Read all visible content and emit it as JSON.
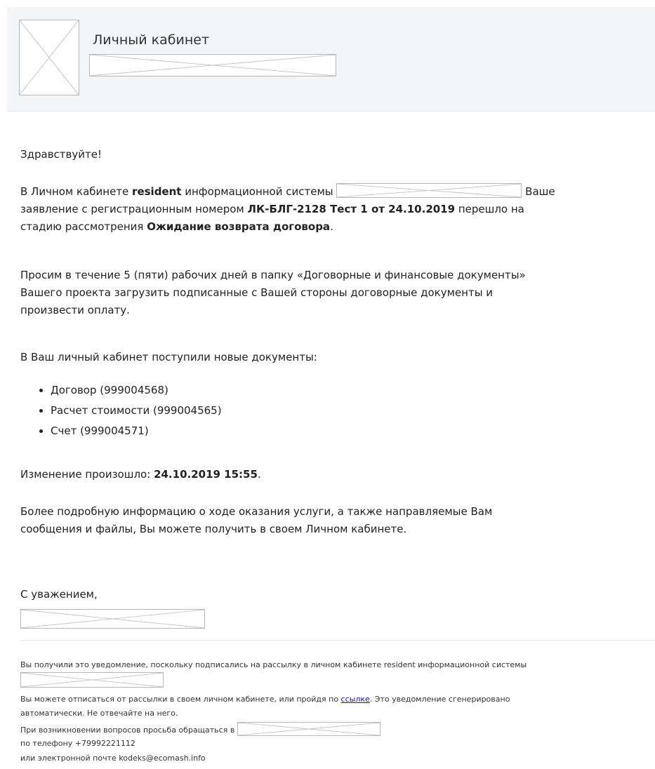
{
  "header": {
    "title": "Личный кабинет"
  },
  "greeting": "Здравствуйте!",
  "status_paragraph": {
    "part1": "В Личном кабинете ",
    "bold_resident": "resident",
    "part2": " информационной системы ",
    "part3": " Ваше",
    "part4": "заявление с регистрационным номером ",
    "bold_regnum": "ЛК-БЛГ-2128 Тест 1 от 24.10.2019",
    "part5": " перешло на",
    "part6": "стадию рассмотрения ",
    "bold_stage": "Ожидание возврата договора",
    "part7": "."
  },
  "request_paragraph": {
    "line1": "Просим в течение 5 (пяти) рабочих дней в папку «Договорные и финансовые документы»",
    "line2": "Вашего проекта загрузить подписанные с Вашей стороны договорные документы и",
    "line3": "произвести оплату."
  },
  "documents_intro": "В Ваш личный кабинет поступили новые документы:",
  "documents": [
    "Договор (999004568)",
    "Расчет стоимости (999004565)",
    "Счет (999004571)"
  ],
  "change": {
    "label": "Изменение произошло: ",
    "datetime": "24.10.2019 15:55",
    "end": "."
  },
  "more_info": {
    "line1": "Более подробную информацию о ходе оказания услуги, а также направляемые Вам",
    "line2": "сообщения и файлы, Вы можете получить в своем Личном кабинете."
  },
  "signoff": "С уважением,",
  "footer": {
    "line1": "Вы получили это уведомление, поскольку подписались на рассылку в личном кабинете resident информационной системы",
    "line2_before_link": "Вы можете отписаться от рассылки в своем личном кабинете, или пройдя по ",
    "link_text": "ссылке",
    "line2_after_link": ". Это уведомление сгенерировано",
    "line3": "автоматически. Не отвечайте на него.",
    "line4": "При возникновении вопросов просьба обращаться в ",
    "line5": "по телефону +79992221112",
    "line6": "или электронной почте kodeks@ecomash.info"
  }
}
